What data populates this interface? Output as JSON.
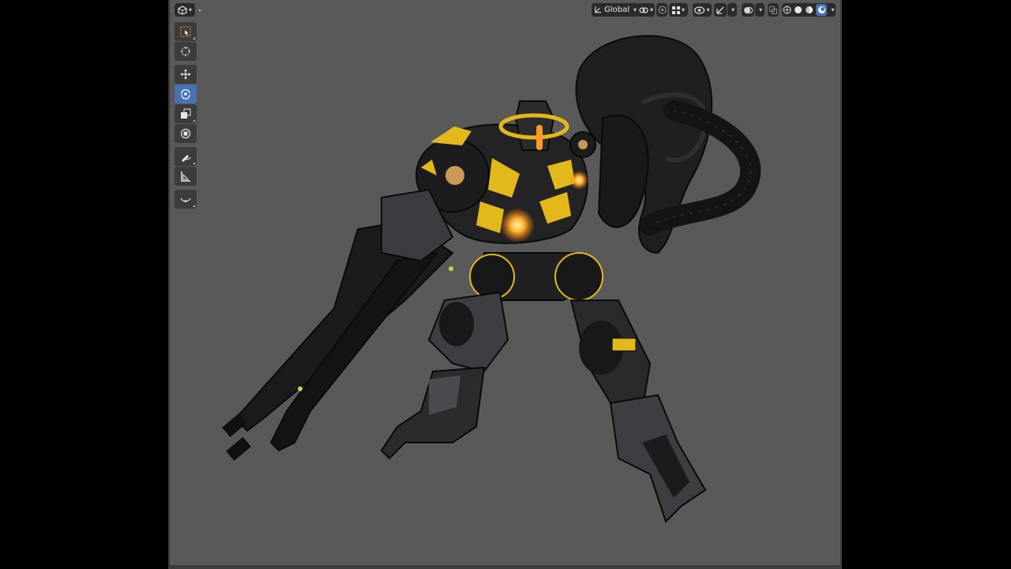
{
  "app": "Blender",
  "editor": "3D Viewport",
  "header": {
    "editor_type_icon": "viewport-3d-icon",
    "orientation_label": "Global",
    "pivot_icon": "snap-link-icon",
    "proportional_icon": "proportional-edit-icon",
    "overlay_icon": "visibility-overlay-icon",
    "gizmo_icon": "gizmo-icon",
    "shading_modes": [
      "wireframe",
      "solid",
      "material-preview",
      "rendered"
    ],
    "active_shading": "rendered"
  },
  "toolbar": {
    "tools": [
      {
        "name": "select-box",
        "icon": "select-box-icon",
        "active": false
      },
      {
        "name": "cursor",
        "icon": "cursor-icon",
        "active": false
      },
      {
        "name": "move",
        "icon": "move-icon",
        "active": false
      },
      {
        "name": "rotate",
        "icon": "rotate-icon",
        "active": true
      },
      {
        "name": "scale",
        "icon": "scale-icon",
        "active": false
      },
      {
        "name": "transform",
        "icon": "transform-icon",
        "active": false
      },
      {
        "name": "annotate",
        "icon": "annotate-icon",
        "active": false
      },
      {
        "name": "measure",
        "icon": "measure-icon",
        "active": false
      },
      {
        "name": "curve-draw",
        "icon": "curve-icon",
        "active": false
      }
    ]
  },
  "scene": {
    "subject": "mech-robot-model",
    "accent_color": "#f2c21b",
    "glow_color": "#ff9a1f",
    "background_color": "#595959"
  },
  "colors": {
    "active_blue": "#4772b3",
    "header_button": "#2b2b2b",
    "tool_button": "#3c3c3c"
  }
}
